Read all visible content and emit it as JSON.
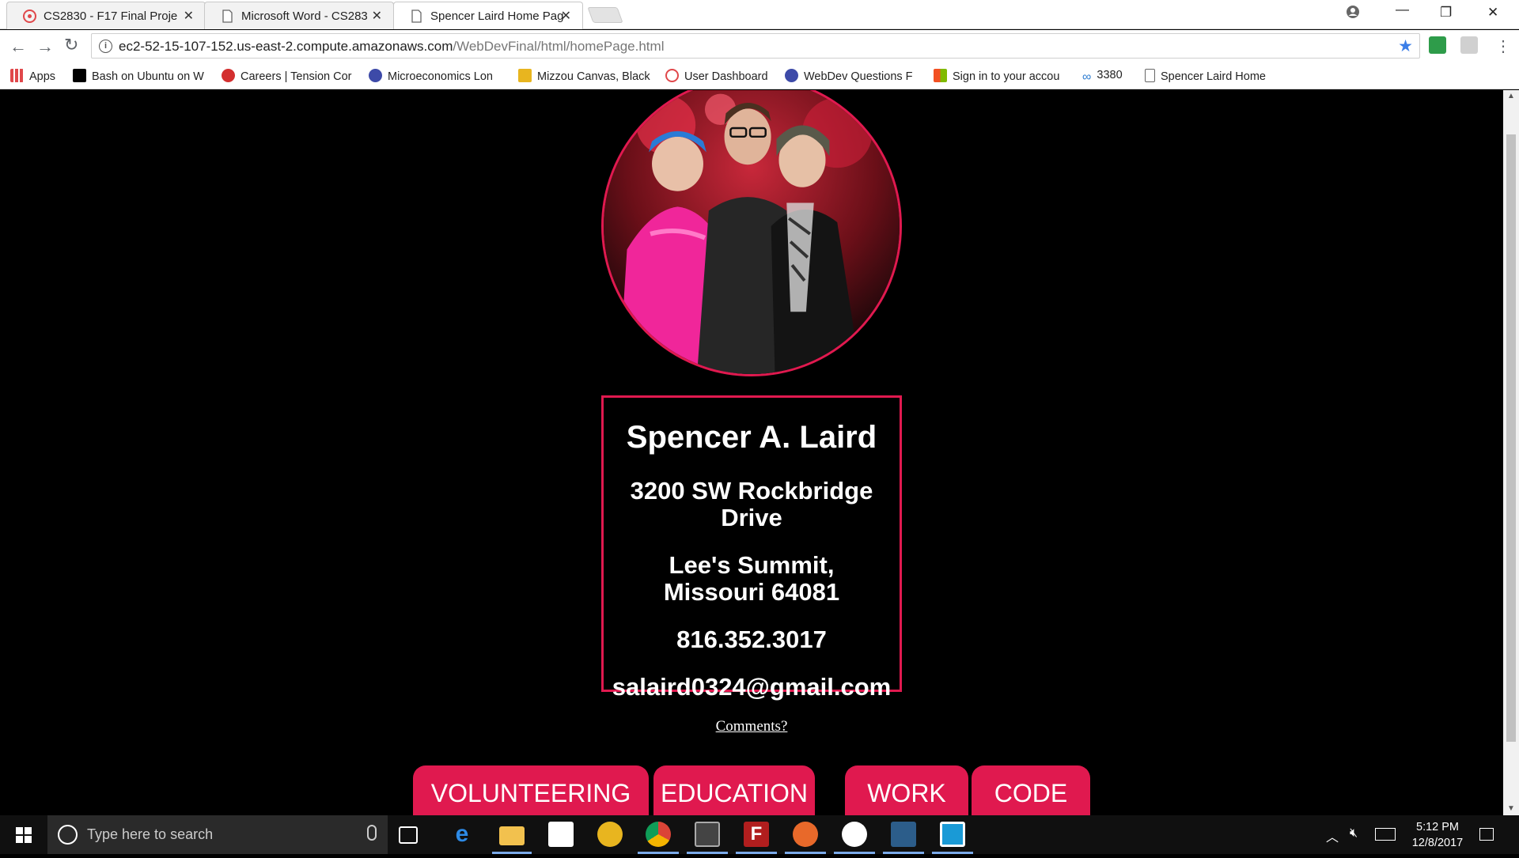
{
  "browser": {
    "tabs": [
      {
        "title": "CS2830 - F17 Final Proje",
        "favicon": "canvas-icon",
        "color": "#e0484b"
      },
      {
        "title": "Microsoft Word - CS283",
        "favicon": "document-icon",
        "color": "#666666"
      },
      {
        "title": "Spencer Laird Home Pag",
        "favicon": "document-icon",
        "color": "#666666"
      }
    ],
    "url_host": "ec2-52-15-107-152.us-east-2.compute.amazonaws.com",
    "url_path": "/WebDevFinal/html/homePage.html",
    "bookmarks": [
      {
        "label": "Apps",
        "icon": "apps-grid-icon",
        "color": "#e0484b"
      },
      {
        "label": "Bash on Ubuntu on W",
        "icon": "medium-icon",
        "color": "#000000"
      },
      {
        "label": "Careers | Tension Cor",
        "icon": "tension-icon",
        "color": "#d32f2f"
      },
      {
        "label": "Microeconomics Lon",
        "icon": "quizlet-icon",
        "color": "#3d4aa8"
      },
      {
        "label": "Mizzou Canvas, Black",
        "icon": "mizzou-icon",
        "color": "#e8b51f"
      },
      {
        "label": "User Dashboard",
        "icon": "canvas-icon",
        "color": "#e0484b"
      },
      {
        "label": "WebDev Questions F",
        "icon": "quizlet-icon",
        "color": "#3d4aa8"
      },
      {
        "label": "Sign in to your accou",
        "icon": "microsoft-icon",
        "color": "#f25022"
      },
      {
        "label": "3380",
        "icon": "infinity-icon",
        "color": "#2e7dd1"
      },
      {
        "label": "Spencer Laird Home",
        "icon": "document-icon",
        "color": "#666666"
      }
    ]
  },
  "profile": {
    "name": "Spencer A. Laird",
    "street": "3200 SW Rockbridge Drive",
    "city": "Lee's Summit, Missouri 64081",
    "phone": "816.352.3017",
    "email": "salaird0324@gmail.com"
  },
  "comments_link": "Comments?",
  "nav": [
    "VOLUNTEERING",
    "EDUCATION",
    "WORK",
    "CODE"
  ],
  "accent_color": "#e0194f",
  "taskbar": {
    "search_placeholder": "Type here to search",
    "time": "5:12 PM",
    "date": "12/8/2017"
  }
}
